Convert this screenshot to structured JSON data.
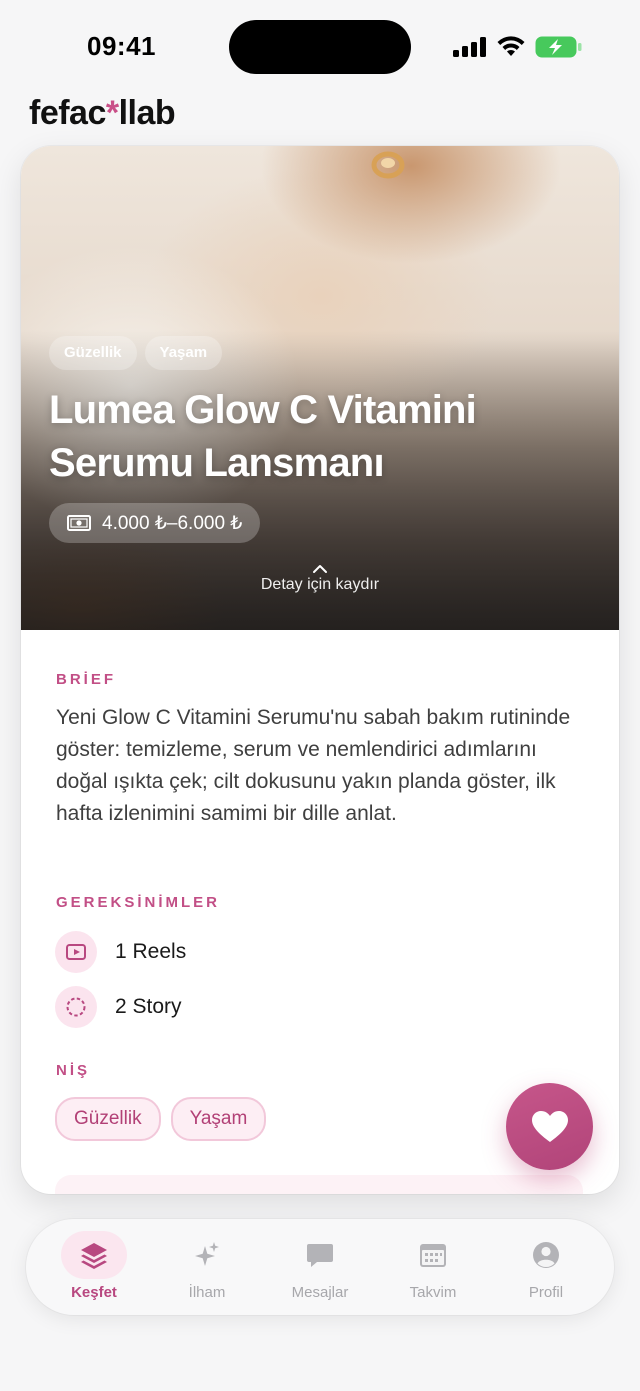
{
  "status_bar": {
    "time": "09:41"
  },
  "header": {
    "logo_part1": "fefac",
    "logo_star": "*",
    "logo_part2": "llab"
  },
  "campaign": {
    "tags": [
      "Güzellik",
      "Yaşam"
    ],
    "title": "Lumea Glow C Vitamini Serumu Lansmanı",
    "budget": "4.000 ₺–6.000 ₺",
    "scroll_hint": "Detay için kaydır"
  },
  "details": {
    "brief_label": "BRİEF",
    "brief_text": "Yeni Glow C Vitamini Serumu'nu sabah bakım rutininde göster: temizleme, serum ve nemlendirici adımlarını doğal ışıkta çek; cilt dokusunu yakın planda göster, ilk hafta izlenimini samimi bir dille anlat.",
    "requirements_label": "GEREKSİNİMLER",
    "requirements": [
      {
        "icon": "play-icon",
        "text": "1 Reels"
      },
      {
        "icon": "story-icon",
        "text": "2 Story"
      }
    ],
    "niche_label": "NİŞ",
    "niches": [
      "Güzellik",
      "Yaşam"
    ]
  },
  "fab": {
    "icon": "heart-icon",
    "color": "#c0508a"
  },
  "tabbar": {
    "tabs": [
      {
        "label": "Keşfet",
        "icon": "layers-icon",
        "active": true
      },
      {
        "label": "İlham",
        "icon": "sparkles-icon",
        "active": false
      },
      {
        "label": "Mesajlar",
        "icon": "chat-icon",
        "active": false
      },
      {
        "label": "Takvim",
        "icon": "calendar-icon",
        "active": false
      },
      {
        "label": "Profil",
        "icon": "profile-icon",
        "active": false
      }
    ]
  },
  "colors": {
    "accent": "#c24f86",
    "accent_light": "#fbe4ee",
    "background": "#f6f6f7"
  }
}
